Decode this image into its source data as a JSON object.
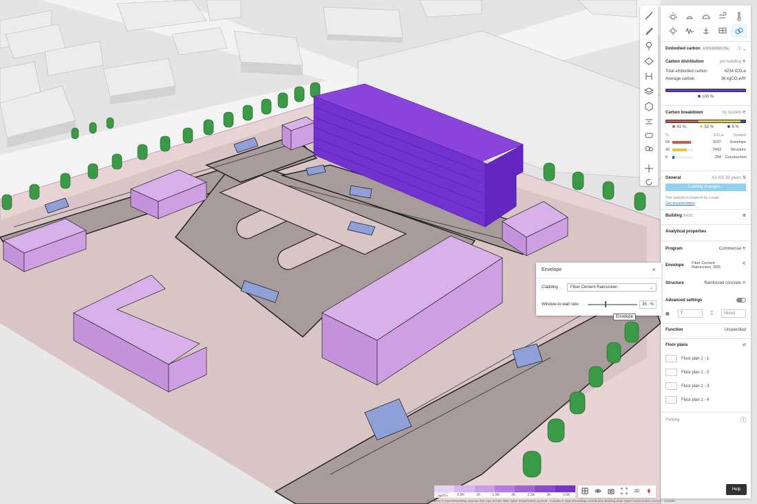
{
  "panel": {
    "section_title": "Embodied carbon",
    "section_badge": "EXPERIMENTAL",
    "carbon_distribution_label": "Carbon distribution",
    "carbon_distribution_mode": "per building",
    "total_label": "Total embodied carbon",
    "total_value": "4254 tCO₂e",
    "avg_label": "Average carbon",
    "avg_value": "36 kgCO₂e/ft²",
    "distribution_pct": "100 %",
    "breakdown_label": "Carbon breakdown",
    "breakdown_mode": "by system",
    "breakdown_pcts": [
      "41 %",
      "53 %",
      "6 %"
    ],
    "breakdown_fractions": [
      0.41,
      0.53,
      0.06
    ],
    "table_header": [
      "%",
      "tCO₂e",
      "System"
    ],
    "table_rows": [
      {
        "pct": "53",
        "value": "3037",
        "system": "Envelope",
        "color": "#c85a5a",
        "fraction": 0.53
      },
      {
        "pct": "42",
        "value": "2453",
        "system": "Structure",
        "color": "#e3c83a",
        "fraction": 0.42
      },
      {
        "pct": "5",
        "value": "294",
        "system": "Construction",
        "color": "#2a5aa0",
        "fraction": 0.05
      }
    ],
    "general_label": "General",
    "general_value": "A1-A3, 30 years",
    "loading_label": "Loading changes...",
    "powered_text": "This analysis is powered by c.scale",
    "docs_link": "See documentation",
    "building_label": "Building",
    "building_badge": "BASIC",
    "analytical_label": "Analytical properties",
    "program_label": "Program",
    "program_value": "Commercial",
    "envelope_label": "Envelope",
    "envelope_value": "Fiber Cement Rainscreen, 35%",
    "structure_label": "Structure",
    "structure_value": "Reinforced concrete",
    "advanced_label": "Advanced settings",
    "floors_value": "7",
    "mixed_placeholder": "Mixed",
    "function_label": "Function",
    "function_value": "Unspecified",
    "floor_plans_label": "Floor plans",
    "floor_plans": [
      "Floor plan 1 - 1",
      "Floor plan 1 - 2",
      "Floor plan 1 - 3",
      "Floor plan 1 - 4"
    ],
    "parking_label": "Parking"
  },
  "envelope": {
    "title": "Envelope",
    "cladding_label": "Cladding",
    "cladding_value": "Fiber Cement Rainscreen",
    "wwr_label": "Window-to-wall ratio",
    "wwr_value": "35",
    "wwr_unit": "%",
    "tooltip": "Envelope"
  },
  "scale": {
    "unit": "kgCO₂e",
    "labels": [
      "0.5K",
      "1K",
      "1.5K",
      "2K",
      "2.5K",
      "3K",
      "3.5K"
    ],
    "colors": [
      "#e5d3f2",
      "#d6b8ee",
      "#c89de8",
      "#b57ee0",
      "#a064d8",
      "#8a47d0",
      "#7535c8"
    ]
  },
  "mapctrl": {
    "mode": "2D"
  },
  "help_label": "Help",
  "attribution": "© Mapbox © OpenStreetMap Improve this map Terrain data: Open Government Licence - Canada © OpenStreetMap contributors Building data: Open Government Licence - Canada"
}
